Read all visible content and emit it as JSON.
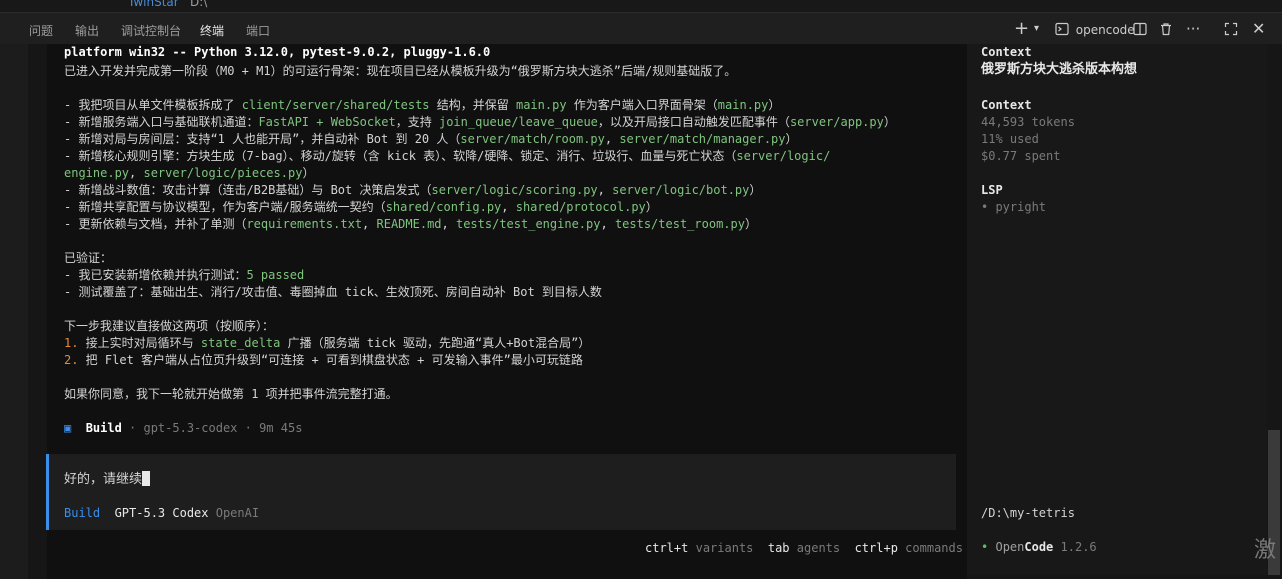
{
  "topbar": {
    "left_text": "TwinStar",
    "right_text": "D:\\"
  },
  "panel_tabs": [
    {
      "label": "问题"
    },
    {
      "label": "输出"
    },
    {
      "label": "调试控制台"
    },
    {
      "label": "终端",
      "active": true
    },
    {
      "label": "端口"
    }
  ],
  "toolbar": {
    "terminal_name": "opencode"
  },
  "terminal": {
    "header_line": "platform win32 -- Python 3.12.0, pytest-9.0.2, pluggy-1.6.0",
    "intro": "已进入开发并完成第一阶段（M0 + M1）的可运行骨架：现在项目已经从模板升级为“俄罗斯方块大逃杀”后端/规则基础版了。",
    "bullets": [
      {
        "pre": "- 我把项目从单文件模板拆成了 ",
        "p1": "client/server/shared/tests",
        "mid": " 结构，并保留 ",
        "p2": "main.py",
        "mid2": " 作为客户端入口界面骨架（",
        "p3": "main.py",
        "post": "）"
      },
      {
        "pre": "- 新增服务端入口与基础联机通道：",
        "p1": "FastAPI + WebSocket",
        "mid": "，支持 ",
        "p2": "join_queue/leave_queue",
        "mid2": "，以及开局接口自动触发匹配事件（",
        "p3": "server/app.py",
        "post": "）"
      },
      {
        "pre": "- 新增对局与房间层：支持“1 人也能开局”，并自动补 Bot 到 20 人（",
        "p1": "server/match/room.py",
        "mid": ", ",
        "p2": "server/match/manager.py",
        "mid2": "",
        "p3": "",
        "post": "）"
      },
      {
        "pre": "- 新增核心规则引擎：方块生成（7-bag）、移动/旋转（含 kick 表）、软降/硬降、锁定、消行、垃圾行、血量与死亡状态（",
        "p1": "server/logic/",
        "mid": "",
        "p2": "",
        "mid2": "",
        "p3": "",
        "post": ""
      },
      {
        "pre": "",
        "p1": "engine.py",
        "mid": ", ",
        "p2": "server/logic/pieces.py",
        "mid2": "",
        "p3": "",
        "post": "）"
      },
      {
        "pre": "- 新增战斗数值：攻击计算（连击/B2B基础）与 Bot 决策启发式（",
        "p1": "server/logic/scoring.py",
        "mid": ", ",
        "p2": "server/logic/bot.py",
        "mid2": "",
        "p3": "",
        "post": "）"
      },
      {
        "pre": "- 新增共享配置与协议模型，作为客户端/服务端统一契约（",
        "p1": "shared/config.py",
        "mid": ", ",
        "p2": "shared/protocol.py",
        "mid2": "",
        "p3": "",
        "post": "）"
      },
      {
        "pre": "- 更新依赖与文档，并补了单测（",
        "p1": "requirements.txt",
        "mid": ", ",
        "p2": "README.md",
        "mid2": ", ",
        "p3": "tests/test_engine.py",
        "post": ", ",
        "p4": "tests/test_room.py",
        "post2": "）"
      }
    ],
    "verified_title": "已验证：",
    "verified_1_pre": "- 我已安装新增依赖并执行测试：",
    "verified_1_val": "5 passed",
    "verified_2": "- 测试覆盖了：基础出生、消行/攻击值、毒圈掉血 tick、生效顶死、房间自动补 Bot 到目标人数",
    "next_title": "下一步我建议直接做这两项（按顺序）：",
    "next_1_num": "1.",
    "next_1_pre": " 接上实时对局循环与 ",
    "next_1_code": "state_delta",
    "next_1_post": " 广播（服务端 tick 驱动，先跑通“真人+Bot混合局”）",
    "next_2_num": "2.",
    "next_2_text": " 把 Flet 客户端从占位页升级到“可连接 + 可看到棋盘状态 + 可发输入事件”最小可玩链路",
    "closing": "如果你同意，我下一轮就开始做第 1 项并把事件流完整打通。",
    "build_icon": "▣",
    "build_label": "Build",
    "build_meta": " · gpt-5.3-codex · 9m 45s"
  },
  "input": {
    "value": "好的，请继续",
    "mode": "Build",
    "model": "GPT-5.3 Codex",
    "provider": "OpenAI"
  },
  "footer": [
    {
      "key": "ctrl+t",
      "desc": "variants"
    },
    {
      "key": "tab",
      "desc": "agents"
    },
    {
      "key": "ctrl+p",
      "desc": "commands"
    }
  ],
  "sidebar": {
    "context_label": "Context",
    "session_title": "俄罗斯方块大逃杀版本构想",
    "context2_label": "Context",
    "tokens": "44,593 tokens",
    "used": "11% used",
    "spent": "$0.77 spent",
    "lsp_label": "LSP",
    "lsp_item": "• pyright",
    "path": "/D:\\my-tetris",
    "version_dot": "•",
    "version_open": "Open",
    "version_code": "Code",
    "version_num": "1.2.6"
  },
  "watermark": "激"
}
